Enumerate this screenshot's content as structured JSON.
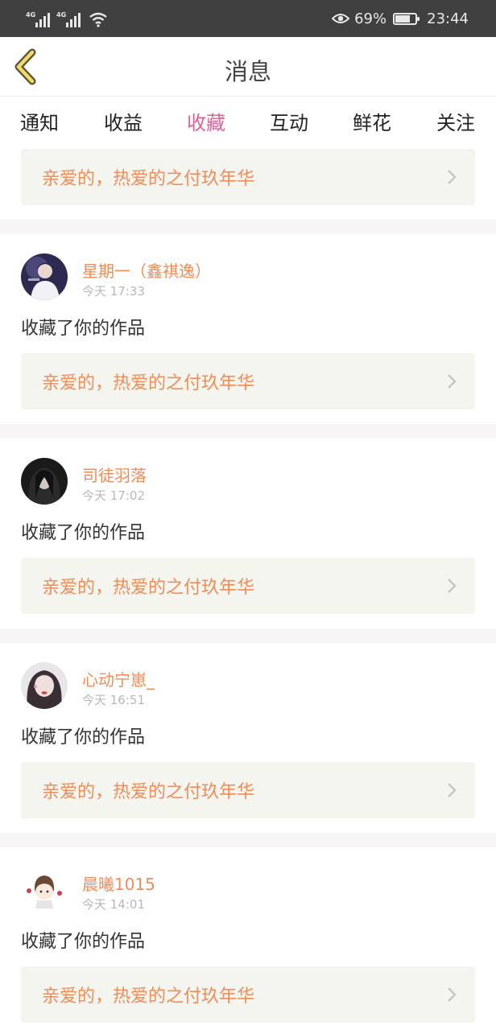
{
  "status": {
    "signal1": "4G",
    "signal2": "4G",
    "battery_text": "69%",
    "battery_level": 0.69,
    "time": "23:44"
  },
  "nav": {
    "title": "消息"
  },
  "tabs": [
    {
      "label": "通知"
    },
    {
      "label": "收益"
    },
    {
      "label": "收藏",
      "active": true
    },
    {
      "label": "互动"
    },
    {
      "label": "鲜花"
    },
    {
      "label": "关注"
    }
  ],
  "top_item": {
    "work_title": "亲爱的，热爱的之付玖年华"
  },
  "items": [
    {
      "user": "星期一（鑫祺逸）",
      "time": "今天 17:33",
      "action": "收藏了你的作品",
      "work_title": "亲爱的，热爱的之付玖年华"
    },
    {
      "user": "司徒羽落",
      "time": "今天 17:02",
      "action": "收藏了你的作品",
      "work_title": "亲爱的，热爱的之付玖年华"
    },
    {
      "user": "心动宁崽_",
      "time": "今天 16:51",
      "action": "收藏了你的作品",
      "work_title": "亲爱的，热爱的之付玖年华"
    },
    {
      "user": "晨曦1015",
      "time": "今天 14:01",
      "action": "收藏了你的作品",
      "work_title": "亲爱的，热爱的之付玖年华"
    }
  ],
  "colors": {
    "accent": "#e0609a",
    "work_title": "#f08c58",
    "status_bar": "#404040"
  }
}
